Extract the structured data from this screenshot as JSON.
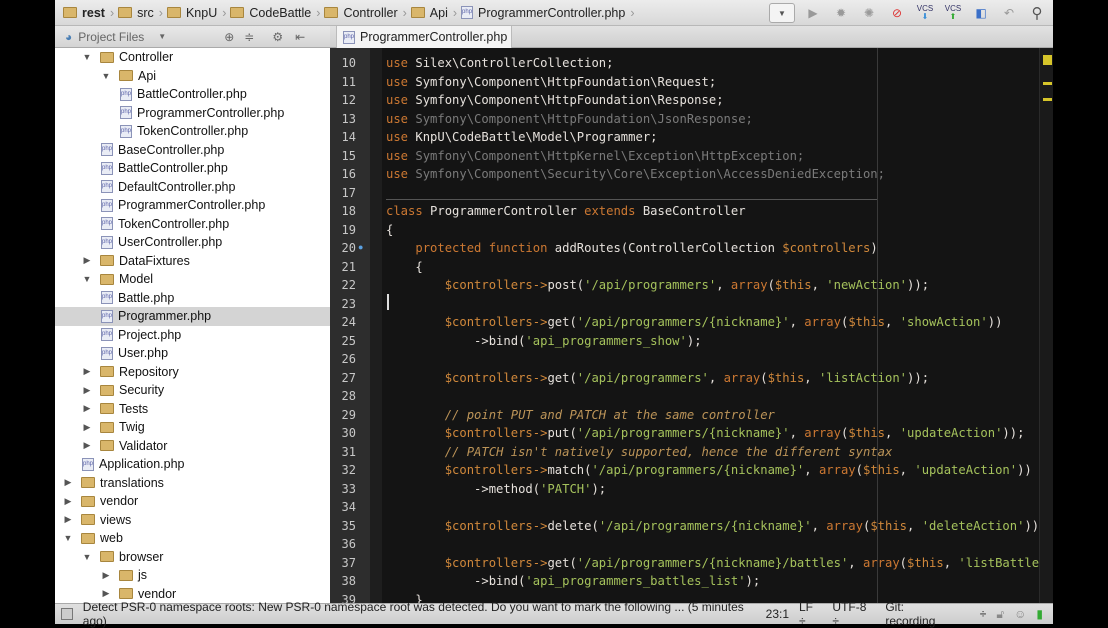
{
  "breadcrumbs": [
    "rest",
    "src",
    "KnpU",
    "CodeBattle",
    "Controller",
    "Api",
    "ProgrammerController.php"
  ],
  "tool_window": {
    "title": "Project Files"
  },
  "tab": {
    "label": "ProgrammerController.php"
  },
  "tree": [
    {
      "label": "Controller",
      "depth": 2,
      "type": "folder",
      "open": true
    },
    {
      "label": "Api",
      "depth": 3,
      "type": "folder",
      "open": true
    },
    {
      "label": "BattleController.php",
      "depth": 4,
      "type": "php"
    },
    {
      "label": "ProgrammerController.php",
      "depth": 4,
      "type": "php"
    },
    {
      "label": "TokenController.php",
      "depth": 4,
      "type": "php"
    },
    {
      "label": "BaseController.php",
      "depth": 3,
      "type": "php"
    },
    {
      "label": "BattleController.php",
      "depth": 3,
      "type": "php"
    },
    {
      "label": "DefaultController.php",
      "depth": 3,
      "type": "php"
    },
    {
      "label": "ProgrammerController.php",
      "depth": 3,
      "type": "php"
    },
    {
      "label": "TokenController.php",
      "depth": 3,
      "type": "php"
    },
    {
      "label": "UserController.php",
      "depth": 3,
      "type": "php"
    },
    {
      "label": "DataFixtures",
      "depth": 2,
      "type": "folder",
      "open": false
    },
    {
      "label": "Model",
      "depth": 2,
      "type": "folder",
      "open": true
    },
    {
      "label": "Battle.php",
      "depth": 3,
      "type": "php"
    },
    {
      "label": "Programmer.php",
      "depth": 3,
      "type": "php",
      "selected": true
    },
    {
      "label": "Project.php",
      "depth": 3,
      "type": "php"
    },
    {
      "label": "User.php",
      "depth": 3,
      "type": "php"
    },
    {
      "label": "Repository",
      "depth": 2,
      "type": "folder",
      "open": false
    },
    {
      "label": "Security",
      "depth": 2,
      "type": "folder",
      "open": false
    },
    {
      "label": "Tests",
      "depth": 2,
      "type": "folder",
      "open": false
    },
    {
      "label": "Twig",
      "depth": 2,
      "type": "folder",
      "open": false
    },
    {
      "label": "Validator",
      "depth": 2,
      "type": "folder",
      "open": false
    },
    {
      "label": "Application.php",
      "depth": 2,
      "type": "php"
    },
    {
      "label": "translations",
      "depth": 1,
      "type": "folder",
      "open": false
    },
    {
      "label": "vendor",
      "depth": 1,
      "type": "folder",
      "open": false
    },
    {
      "label": "views",
      "depth": 1,
      "type": "folder",
      "open": false
    },
    {
      "label": "web",
      "depth": 1,
      "type": "folder",
      "open": true
    },
    {
      "label": "browser",
      "depth": 2,
      "type": "folder",
      "open": true
    },
    {
      "label": "js",
      "depth": 3,
      "type": "folder",
      "open": false
    },
    {
      "label": "vendor",
      "depth": 3,
      "type": "folder",
      "open": false
    }
  ],
  "code": [
    {
      "n": "10",
      "t": [
        [
          "k",
          "use "
        ],
        [
          "p",
          "Silex\\ControllerCollection;"
        ]
      ]
    },
    {
      "n": "11",
      "t": [
        [
          "k",
          "use "
        ],
        [
          "p",
          "Symfony\\Component\\HttpFoundation\\Request;"
        ]
      ]
    },
    {
      "n": "12",
      "t": [
        [
          "k",
          "use "
        ],
        [
          "p",
          "Symfony\\Component\\HttpFoundation\\Response;"
        ]
      ]
    },
    {
      "n": "13",
      "t": [
        [
          "k",
          "use "
        ],
        [
          "g",
          "Symfony\\Component\\HttpFoundation\\JsonResponse;"
        ]
      ]
    },
    {
      "n": "14",
      "t": [
        [
          "k",
          "use "
        ],
        [
          "p",
          "KnpU\\CodeBattle\\Model\\Programmer;"
        ]
      ]
    },
    {
      "n": "15",
      "t": [
        [
          "k",
          "use "
        ],
        [
          "g",
          "Symfony\\Component\\HttpKernel\\Exception\\HttpException;"
        ]
      ]
    },
    {
      "n": "16",
      "t": [
        [
          "k",
          "use "
        ],
        [
          "g",
          "Symfony\\Component\\Security\\Core\\Exception\\AccessDeniedException;"
        ]
      ]
    },
    {
      "n": "17",
      "t": []
    },
    {
      "n": "18",
      "t": [
        [
          "k",
          "class "
        ],
        [
          "p",
          "ProgrammerController "
        ],
        [
          "k",
          "extends "
        ],
        [
          "p",
          "BaseController"
        ]
      ]
    },
    {
      "n": "19",
      "t": [
        [
          "p",
          "{"
        ]
      ]
    },
    {
      "n": "20",
      "t": [
        [
          "p",
          "    "
        ],
        [
          "k",
          "protected function "
        ],
        [
          "p",
          "addRoutes(ControllerCollection "
        ],
        [
          "v",
          "$controllers"
        ],
        [
          "p",
          ")"
        ]
      ]
    },
    {
      "n": "21",
      "t": [
        [
          "p",
          "    {"
        ]
      ]
    },
    {
      "n": "22",
      "t": [
        [
          "p",
          "        "
        ],
        [
          "v",
          "$controllers->"
        ],
        [
          "p",
          "post("
        ],
        [
          "s",
          "'/api/programmers'"
        ],
        [
          "p",
          ", "
        ],
        [
          "k",
          "array"
        ],
        [
          "p",
          "("
        ],
        [
          "v",
          "$this"
        ],
        [
          "p",
          ", "
        ],
        [
          "s",
          "'newAction'"
        ],
        [
          "p",
          "));"
        ]
      ]
    },
    {
      "n": "23",
      "t": []
    },
    {
      "n": "24",
      "t": [
        [
          "p",
          "        "
        ],
        [
          "v",
          "$controllers->"
        ],
        [
          "p",
          "get("
        ],
        [
          "s",
          "'/api/programmers/{nickname}'"
        ],
        [
          "p",
          ", "
        ],
        [
          "k",
          "array"
        ],
        [
          "p",
          "("
        ],
        [
          "v",
          "$this"
        ],
        [
          "p",
          ", "
        ],
        [
          "s",
          "'showAction'"
        ],
        [
          "p",
          "))"
        ]
      ]
    },
    {
      "n": "25",
      "t": [
        [
          "p",
          "            ->bind("
        ],
        [
          "s",
          "'api_programmers_show'"
        ],
        [
          "p",
          ");"
        ]
      ]
    },
    {
      "n": "26",
      "t": []
    },
    {
      "n": "27",
      "t": [
        [
          "p",
          "        "
        ],
        [
          "v",
          "$controllers->"
        ],
        [
          "p",
          "get("
        ],
        [
          "s",
          "'/api/programmers'"
        ],
        [
          "p",
          ", "
        ],
        [
          "k",
          "array"
        ],
        [
          "p",
          "("
        ],
        [
          "v",
          "$this"
        ],
        [
          "p",
          ", "
        ],
        [
          "s",
          "'listAction'"
        ],
        [
          "p",
          "));"
        ]
      ]
    },
    {
      "n": "28",
      "t": []
    },
    {
      "n": "29",
      "t": [
        [
          "p",
          "        "
        ],
        [
          "c",
          "// point PUT and PATCH at the same controller"
        ]
      ]
    },
    {
      "n": "30",
      "t": [
        [
          "p",
          "        "
        ],
        [
          "v",
          "$controllers->"
        ],
        [
          "p",
          "put("
        ],
        [
          "s",
          "'/api/programmers/{nickname}'"
        ],
        [
          "p",
          ", "
        ],
        [
          "k",
          "array"
        ],
        [
          "p",
          "("
        ],
        [
          "v",
          "$this"
        ],
        [
          "p",
          ", "
        ],
        [
          "s",
          "'updateAction'"
        ],
        [
          "p",
          "));"
        ]
      ]
    },
    {
      "n": "31",
      "t": [
        [
          "p",
          "        "
        ],
        [
          "c",
          "// PATCH isn't natively supported, hence the different syntax"
        ]
      ]
    },
    {
      "n": "32",
      "t": [
        [
          "p",
          "        "
        ],
        [
          "v",
          "$controllers->"
        ],
        [
          "p",
          "match("
        ],
        [
          "s",
          "'/api/programmers/{nickname}'"
        ],
        [
          "p",
          ", "
        ],
        [
          "k",
          "array"
        ],
        [
          "p",
          "("
        ],
        [
          "v",
          "$this"
        ],
        [
          "p",
          ", "
        ],
        [
          "s",
          "'updateAction'"
        ],
        [
          "p",
          "))"
        ]
      ]
    },
    {
      "n": "33",
      "t": [
        [
          "p",
          "            ->method("
        ],
        [
          "s",
          "'PATCH'"
        ],
        [
          "p",
          ");"
        ]
      ]
    },
    {
      "n": "34",
      "t": []
    },
    {
      "n": "35",
      "t": [
        [
          "p",
          "        "
        ],
        [
          "v",
          "$controllers->"
        ],
        [
          "p",
          "delete("
        ],
        [
          "s",
          "'/api/programmers/{nickname}'"
        ],
        [
          "p",
          ", "
        ],
        [
          "k",
          "array"
        ],
        [
          "p",
          "("
        ],
        [
          "v",
          "$this"
        ],
        [
          "p",
          ", "
        ],
        [
          "s",
          "'deleteAction'"
        ],
        [
          "p",
          "));"
        ]
      ]
    },
    {
      "n": "36",
      "t": []
    },
    {
      "n": "37",
      "t": [
        [
          "p",
          "        "
        ],
        [
          "v",
          "$controllers->"
        ],
        [
          "p",
          "get("
        ],
        [
          "s",
          "'/api/programmers/{nickname}/battles'"
        ],
        [
          "p",
          ", "
        ],
        [
          "k",
          "array"
        ],
        [
          "p",
          "("
        ],
        [
          "v",
          "$this"
        ],
        [
          "p",
          ", "
        ],
        [
          "s",
          "'listBattlesAction'"
        ]
      ]
    },
    {
      "n": "38",
      "t": [
        [
          "p",
          "            ->bind("
        ],
        [
          "s",
          "'api_programmers_battles_list'"
        ],
        [
          "p",
          ");"
        ]
      ]
    },
    {
      "n": "39",
      "t": [
        [
          "p",
          "    }"
        ]
      ]
    }
  ],
  "status": {
    "message": "Detect PSR-0 namespace roots: New PSR-0 namespace root was detected. Do you want to mark the following ... (5 minutes ago)",
    "position": "23:1",
    "line_ending": "LF ÷",
    "encoding": "UTF-8 ÷",
    "vcs": "Git: recording",
    "vcs_arrow": "÷"
  },
  "toolbar": {
    "vcs_update": "VCS",
    "vcs_commit": "VCS"
  }
}
